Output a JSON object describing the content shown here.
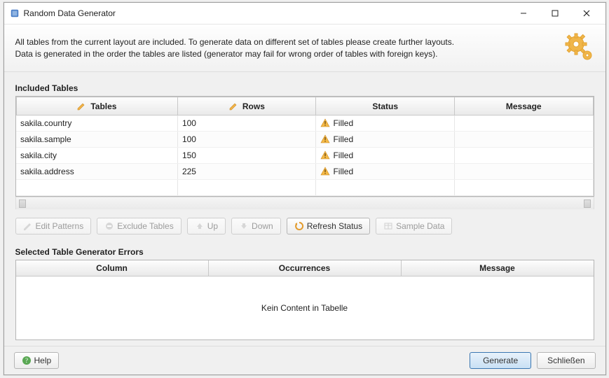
{
  "window": {
    "title": "Random Data Generator"
  },
  "header": {
    "line1": "All tables from the current layout are included. To generate data on different set of tables please create further layouts.",
    "line2": "Data is generated in the order the tables are listed (generator may fail for wrong order of tables with foreign keys)."
  },
  "tables_section": {
    "label": "Included Tables",
    "columns": {
      "tables": "Tables",
      "rows": "Rows",
      "status": "Status",
      "message": "Message"
    },
    "rows": [
      {
        "table": "sakila.country",
        "rows": "100",
        "status": "Filled",
        "message": ""
      },
      {
        "table": "sakila.sample",
        "rows": "100",
        "status": "Filled",
        "message": ""
      },
      {
        "table": "sakila.city",
        "rows": "150",
        "status": "Filled",
        "message": ""
      },
      {
        "table": "sakila.address",
        "rows": "225",
        "status": "Filled",
        "message": ""
      }
    ]
  },
  "toolbar": {
    "edit_patterns": "Edit Patterns",
    "exclude_tables": "Exclude Tables",
    "up": "Up",
    "down": "Down",
    "refresh_status": "Refresh Status",
    "sample_data": "Sample Data"
  },
  "errors_section": {
    "label": "Selected Table Generator Errors",
    "columns": {
      "column": "Column",
      "occurrences": "Occurrences",
      "message": "Message"
    },
    "empty_text": "Kein Content in Tabelle"
  },
  "footer": {
    "help": "Help",
    "generate": "Generate",
    "close": "Schließen"
  }
}
